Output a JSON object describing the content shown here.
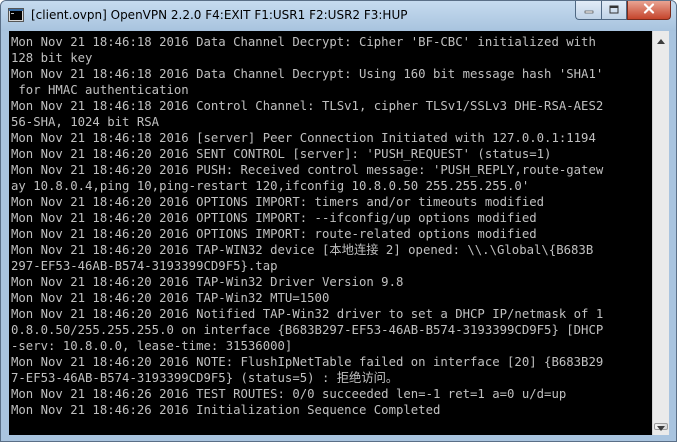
{
  "window": {
    "title": "[client.ovpn] OpenVPN 2.2.0 F4:EXIT F1:USR1 F2:USR2 F3:HUP"
  },
  "icons": {
    "app": "console-app-icon",
    "minimize": "minimize-icon",
    "maximize": "maximize-icon",
    "close": "close-icon",
    "scroll_up": "arrow-up-icon",
    "scroll_down": "arrow-down-icon"
  },
  "colors": {
    "console_background": "#000000",
    "console_text": "#c0c0c0",
    "close_button": "#c5452c"
  },
  "console": {
    "lines": [
      "Mon Nov 21 18:46:18 2016 Data Channel Decrypt: Cipher 'BF-CBC' initialized with",
      "128 bit key",
      "Mon Nov 21 18:46:18 2016 Data Channel Decrypt: Using 160 bit message hash 'SHA1'",
      " for HMAC authentication",
      "Mon Nov 21 18:46:18 2016 Control Channel: TLSv1, cipher TLSv1/SSLv3 DHE-RSA-AES2",
      "56-SHA, 1024 bit RSA",
      "Mon Nov 21 18:46:18 2016 [server] Peer Connection Initiated with 127.0.0.1:1194",
      "Mon Nov 21 18:46:20 2016 SENT CONTROL [server]: 'PUSH_REQUEST' (status=1)",
      "Mon Nov 21 18:46:20 2016 PUSH: Received control message: 'PUSH_REPLY,route-gatew",
      "ay 10.8.0.4,ping 10,ping-restart 120,ifconfig 10.8.0.50 255.255.255.0'",
      "Mon Nov 21 18:46:20 2016 OPTIONS IMPORT: timers and/or timeouts modified",
      "Mon Nov 21 18:46:20 2016 OPTIONS IMPORT: --ifconfig/up options modified",
      "Mon Nov 21 18:46:20 2016 OPTIONS IMPORT: route-related options modified",
      "Mon Nov 21 18:46:20 2016 TAP-WIN32 device [本地连接 2] opened: \\\\.\\Global\\{B683B",
      "297-EF53-46AB-B574-3193399CD9F5}.tap",
      "Mon Nov 21 18:46:20 2016 TAP-Win32 Driver Version 9.8",
      "Mon Nov 21 18:46:20 2016 TAP-Win32 MTU=1500",
      "Mon Nov 21 18:46:20 2016 Notified TAP-Win32 driver to set a DHCP IP/netmask of 1",
      "0.8.0.50/255.255.255.0 on interface {B683B297-EF53-46AB-B574-3193399CD9F5} [DHCP",
      "-serv: 10.8.0.0, lease-time: 31536000]",
      "Mon Nov 21 18:46:20 2016 NOTE: FlushIpNetTable failed on interface [20] {B683B29",
      "7-EF53-46AB-B574-3193399CD9F5} (status=5) : 拒绝访问。",
      "Mon Nov 21 18:46:26 2016 TEST ROUTES: 0/0 succeeded len=-1 ret=1 a=0 u/d=up",
      "Mon Nov 21 18:46:26 2016 Initialization Sequence Completed"
    ]
  }
}
